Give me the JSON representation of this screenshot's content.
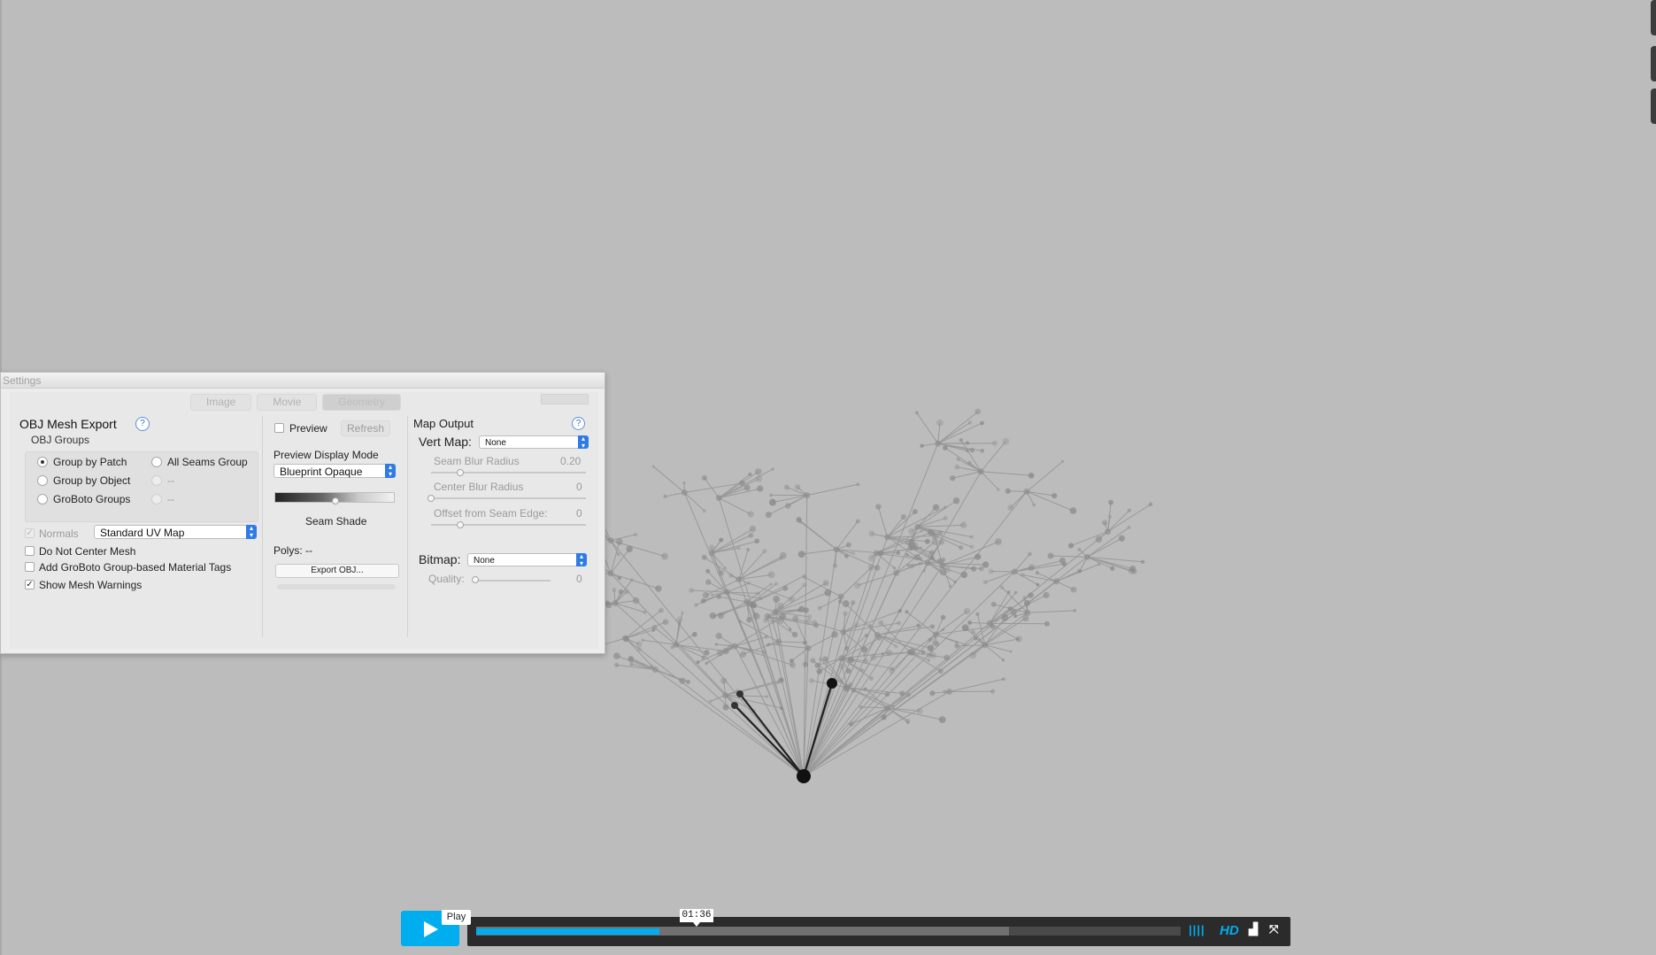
{
  "dialog": {
    "title": "Settings",
    "tabs": [
      "Image",
      "Movie",
      "Geometry"
    ],
    "obj_export": {
      "title": "OBJ Mesh Export",
      "help": "?",
      "groups_label": "OBJ Groups",
      "group_by_patch": "Group by Patch",
      "all_seams_group": "All Seams Group",
      "group_by_object": "Group by Object",
      "groboto_groups": "GroBoto Groups",
      "placeholder_1": "--",
      "placeholder_2": "--",
      "normals_label": "Normals",
      "uv_map_value": "Standard UV Map",
      "do_not_center": "Do Not Center Mesh",
      "add_material_tags": "Add GroBoto Group-based Material Tags",
      "show_warnings": "Show Mesh Warnings"
    },
    "preview": {
      "preview_label": "Preview",
      "refresh_label": "Refresh",
      "display_mode_label": "Preview Display Mode",
      "display_mode_value": "Blueprint Opaque",
      "seam_shade_label": "Seam Shade",
      "polys_label": "Polys: --",
      "export_button": "Export OBJ..."
    },
    "map_output": {
      "title": "Map Output",
      "help": "?",
      "vert_map_label": "Vert Map:",
      "vert_map_value": "None",
      "seam_blur_label": "Seam Blur Radius",
      "seam_blur_value": "0.20",
      "center_blur_label": "Center Blur Radius",
      "center_blur_value": "0",
      "offset_label": "Offset from Seam Edge:",
      "offset_value": "0",
      "bitmap_label": "Bitmap:",
      "bitmap_value": "None",
      "quality_label": "Quality:",
      "quality_value": "0"
    }
  },
  "player": {
    "play_tooltip": "Play",
    "time": "01:36",
    "played_fraction": 0.26,
    "buffered_fraction": 0.756,
    "hd_label": "HD",
    "accent": "#00adef"
  }
}
